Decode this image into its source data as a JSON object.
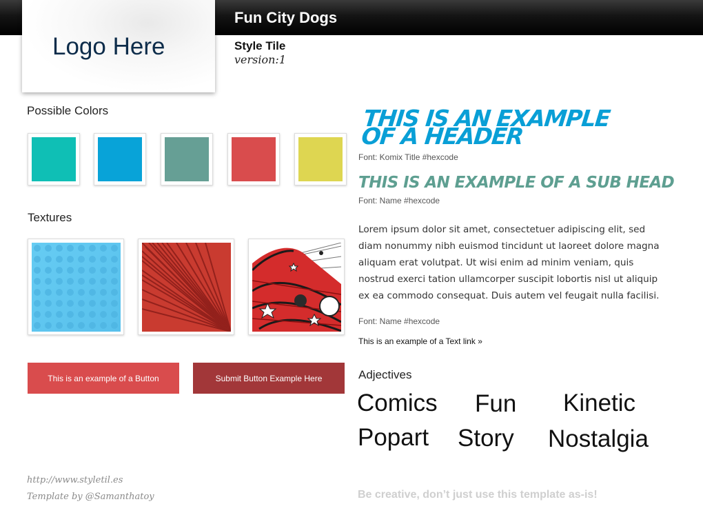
{
  "header": {
    "site_title": "Fun City Dogs",
    "logo_text": "Logo Here",
    "style_tile_label": "Style Tile",
    "version_label": "version:1"
  },
  "colors": {
    "heading": "Possible Colors",
    "swatches": [
      "#0fbfb5",
      "#08a3d8",
      "#669f95",
      "#d94c4d",
      "#ded651"
    ]
  },
  "textures": {
    "heading": "Textures",
    "items": [
      "blue-halftone-dots",
      "red-sunburst-rays",
      "comic-space-explosion"
    ]
  },
  "buttons": {
    "primary_label": "This is an example of a Button",
    "primary_color": "#d94c4d",
    "submit_label": "Submit Button Example Here",
    "submit_color": "#a23739"
  },
  "typography": {
    "header_line1": "THIS IS AN EXAMPLE",
    "header_line2": "OF A HEADER",
    "header_font_note": "Font: Komix Title #hexcode",
    "subhead": "THIS IS AN EXAMPLE OF A SUB HEAD",
    "subhead_font_note": "Font: Name #hexcode",
    "body_text": "Lorem ipsum dolor sit amet, consectetuer adipiscing elit, sed diam nonummy nibh euismod tincidunt ut laoreet dolore magna aliquam erat volutpat. Ut wisi enim ad minim veniam, quis nostrud exerci tation ullamcorper suscipit lobortis nisl ut aliquip ex ea commodo consequat. Duis autem vel feugait nulla facilisi.",
    "body_font_note": "Font: Name #hexcode",
    "text_link": "This is an example of a Text link »"
  },
  "adjectives": {
    "heading": "Adjectives",
    "words": [
      "Comics",
      "Fun",
      "Kinetic",
      "Popart",
      "Story",
      "Nostalgia"
    ]
  },
  "footer": {
    "url": "http://www.styletil.es",
    "credit": "Template by @Samanthatoy",
    "tagline": "Be creative, don’t just use this template as-is!"
  }
}
